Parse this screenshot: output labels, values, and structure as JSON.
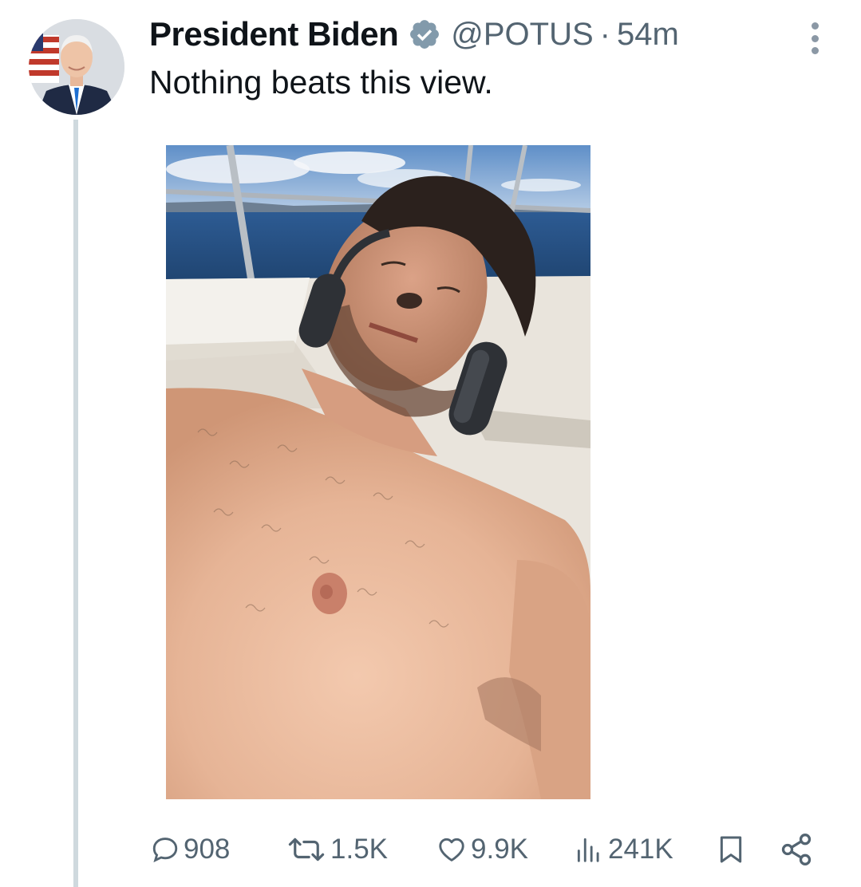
{
  "tweet": {
    "author": {
      "display_name": "President Biden",
      "verified": true,
      "handle": "@POTUS"
    },
    "separator": "·",
    "time": "54m",
    "text": "Nothing beats this view.",
    "media": {
      "type": "photo",
      "alt": "Shirtless man with headphones lying in the sun on a boat deck, sea and sky behind him"
    },
    "stats": {
      "replies": "908",
      "retweets": "1.5K",
      "likes": "9.9K",
      "views": "241K"
    }
  },
  "icons": {
    "verified": "verified-badge-icon",
    "more": "more-icon",
    "reply": "reply-icon",
    "retweet": "retweet-icon",
    "like": "heart-icon",
    "views": "views-icon",
    "bookmark": "bookmark-icon",
    "share": "share-icon"
  },
  "colors": {
    "text": "#0f1419",
    "secondary": "#536471",
    "thread_line": "#cfd9de",
    "verified_badge": "#829aab"
  }
}
